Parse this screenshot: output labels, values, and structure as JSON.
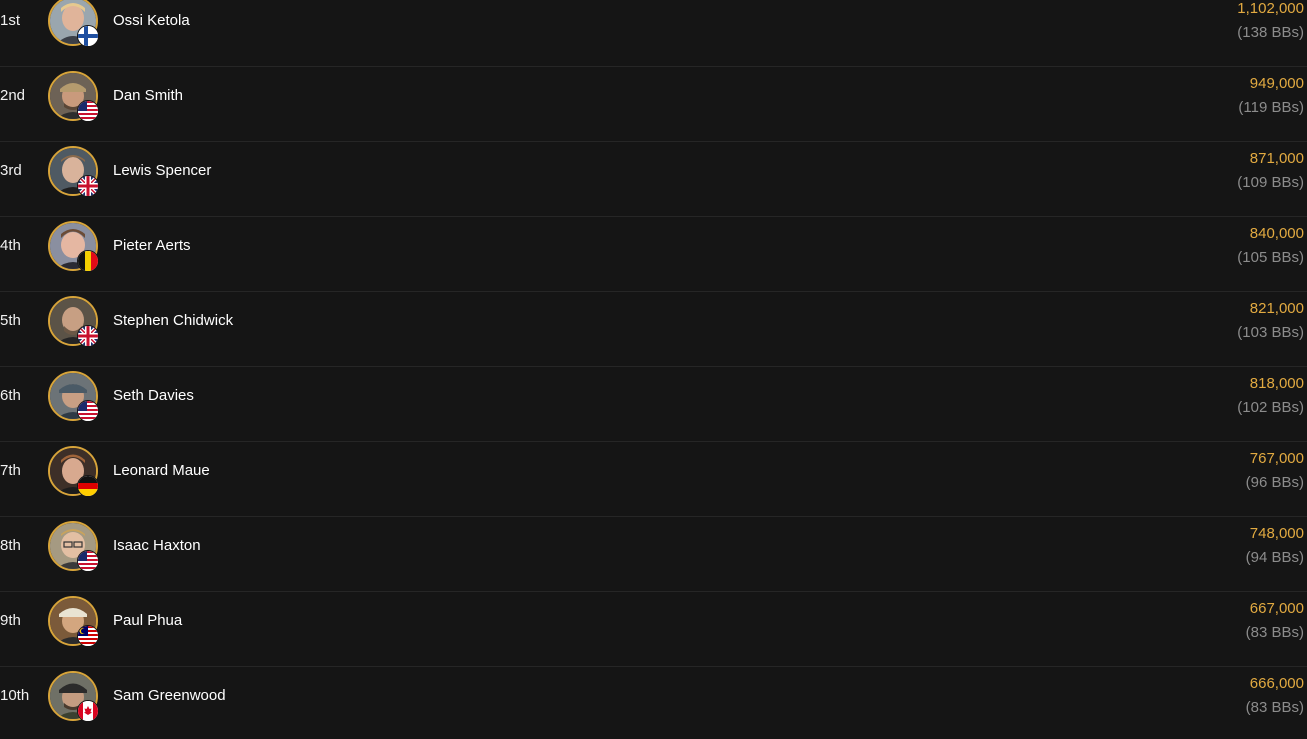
{
  "colors": {
    "background": "#151515",
    "divider": "#262626",
    "chips": "#e2aa41",
    "bbs": "#8c8c8c",
    "avatar_ring": "#d7a43a"
  },
  "players": [
    {
      "rank": "1st",
      "name": "Ossi Ketola",
      "chips": "1,102,000",
      "bbs": "(138 BBs)",
      "flag": "finland-flag-icon"
    },
    {
      "rank": "2nd",
      "name": "Dan Smith",
      "chips": "949,000",
      "bbs": "(119 BBs)",
      "flag": "usa-flag-icon"
    },
    {
      "rank": "3rd",
      "name": "Lewis Spencer",
      "chips": "871,000",
      "bbs": "(109 BBs)",
      "flag": "uk-flag-icon"
    },
    {
      "rank": "4th",
      "name": "Pieter Aerts",
      "chips": "840,000",
      "bbs": "(105 BBs)",
      "flag": "belgium-flag-icon"
    },
    {
      "rank": "5th",
      "name": "Stephen Chidwick",
      "chips": "821,000",
      "bbs": "(103 BBs)",
      "flag": "uk-flag-icon"
    },
    {
      "rank": "6th",
      "name": "Seth Davies",
      "chips": "818,000",
      "bbs": "(102 BBs)",
      "flag": "usa-flag-icon"
    },
    {
      "rank": "7th",
      "name": "Leonard Maue",
      "chips": "767,000",
      "bbs": "(96 BBs)",
      "flag": "germany-flag-icon"
    },
    {
      "rank": "8th",
      "name": "Isaac Haxton",
      "chips": "748,000",
      "bbs": "(94 BBs)",
      "flag": "usa-flag-icon"
    },
    {
      "rank": "9th",
      "name": "Paul Phua",
      "chips": "667,000",
      "bbs": "(83 BBs)",
      "flag": "malaysia-flag-icon"
    },
    {
      "rank": "10th",
      "name": "Sam Greenwood",
      "chips": "666,000",
      "bbs": "(83 BBs)",
      "flag": "canada-flag-icon"
    }
  ]
}
